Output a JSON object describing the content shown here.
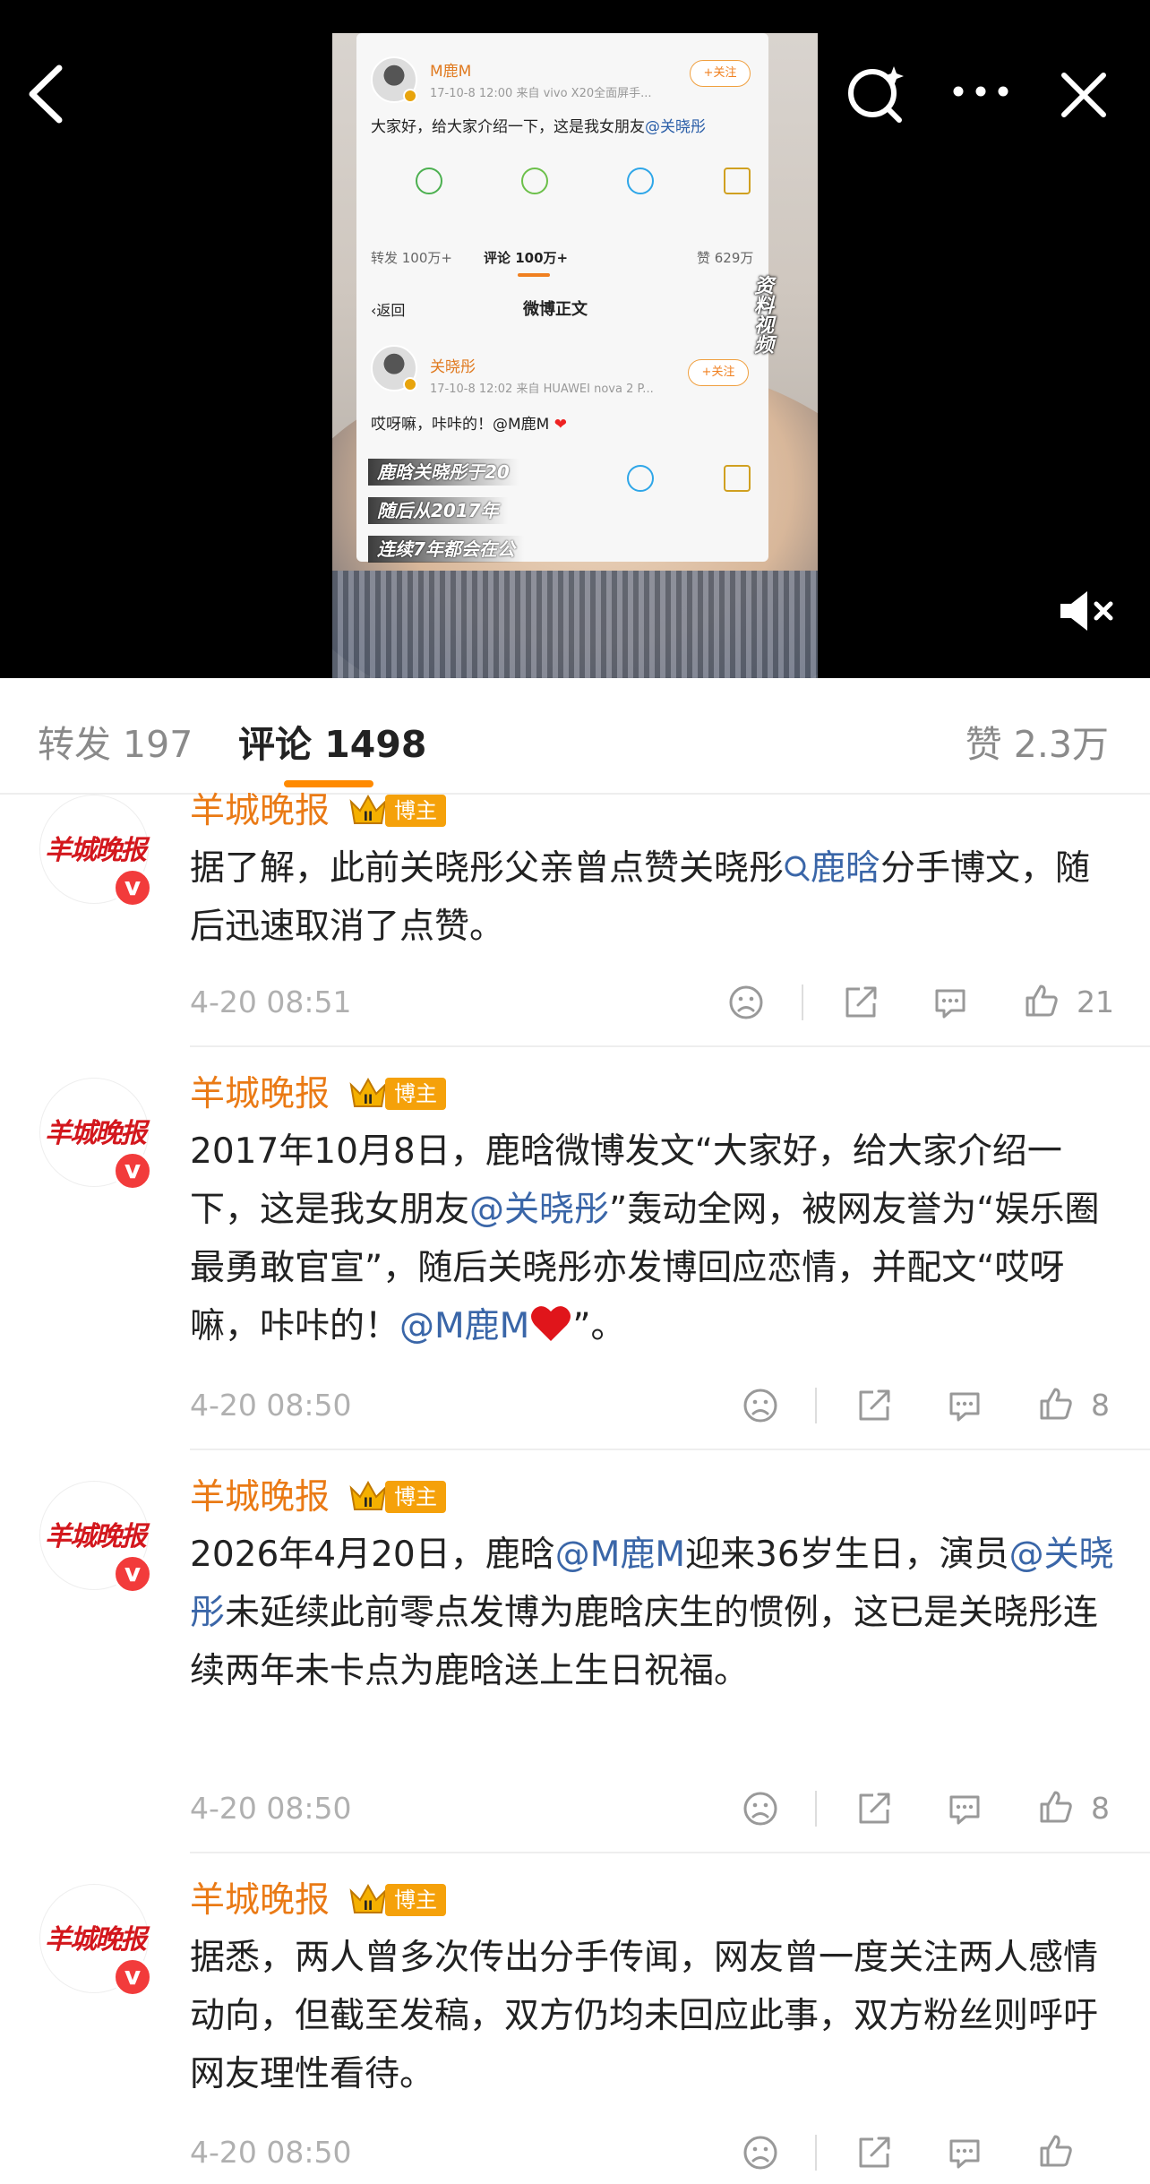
{
  "video": {
    "post1": {
      "name": "M鹿M",
      "meta": "17-10-8 12:00  来自 vivo X20全面屏手...",
      "follow": "+关注",
      "text_prefix": "大家好，给大家介绍一下，这是我女朋友",
      "text_mention": "@关晓彤"
    },
    "stats": {
      "repost": "转发 100万+",
      "comment": "评论 100万+",
      "like": "赞 629万"
    },
    "subpage": {
      "back": "返回",
      "title": "微博正文"
    },
    "post2": {
      "name": "关晓彤",
      "meta": "17-10-8 12:02  来自 HUAWEI nova 2 P...",
      "follow": "+关注",
      "text": "哎呀嘛，咔咔的！@M鹿M"
    },
    "captions": [
      "鹿晗关晓彤于20",
      "随后从2017年",
      "连续7年都会在公"
    ],
    "vertical_tag": "资料视频"
  },
  "tabs": {
    "repost": "转发 197",
    "comment": "评论 1498",
    "like": "赞 2.3万"
  },
  "comments": [
    {
      "author": "羊城晚报",
      "avatar_text": "羊城晚报",
      "badge": "博主",
      "body": [
        {
          "t": "据了解，此前关晓彤父亲曾点赞关晓彤"
        },
        {
          "t": "鹿晗",
          "link": true,
          "search": true
        },
        {
          "t": "分手博文，随后迅速取消了点赞。"
        }
      ],
      "time": "4-20 08:51",
      "likes": "21"
    },
    {
      "author": "羊城晚报",
      "avatar_text": "羊城晚报",
      "badge": "博主",
      "body": [
        {
          "t": "2017年10月8日，鹿晗微博发文“大家好，给大家介绍一下，这是我女朋友"
        },
        {
          "t": "@关晓彤",
          "link": true
        },
        {
          "t": "”轰动全网，被网友誉为“娱乐圈最勇敢官宣”，随后关晓彤亦发博回应恋情，并配文“哎呀嘛，咔咔的！"
        },
        {
          "t": "@M鹿M",
          "link": true
        },
        {
          "t": "",
          "heart": true
        },
        {
          "t": "”。"
        }
      ],
      "time": "4-20 08:50",
      "likes": "8"
    },
    {
      "author": "羊城晚报",
      "avatar_text": "羊城晚报",
      "badge": "博主",
      "body": [
        {
          "t": "2026年4月20日，鹿晗"
        },
        {
          "t": "@M鹿M",
          "link": true
        },
        {
          "t": "迎来36岁生日，演员"
        },
        {
          "t": "@关晓彤",
          "link": true
        },
        {
          "t": "未延续此前零点发博为鹿晗庆生的惯例，这已是关晓彤连续两年未卡点为鹿晗送上生日祝福。"
        }
      ],
      "time": "4-20 08:50",
      "likes": "8"
    },
    {
      "author": "羊城晚报",
      "avatar_text": "羊城晚报",
      "badge": "博主",
      "body": [
        {
          "t": "据悉，两人曾多次传出分手传闻，网友曾一度关注两人感情动向，但截至发稿，双方仍均未回应此事，双方粉丝则呼吁网友理性看待。"
        }
      ],
      "time": "4-20 08:50",
      "likes": ""
    }
  ],
  "colors": {
    "accent": "#ff8a00",
    "author": "#ea7a15",
    "link": "#3a66a8",
    "badge": "#f5a10a",
    "verified": "#f23b3b"
  }
}
